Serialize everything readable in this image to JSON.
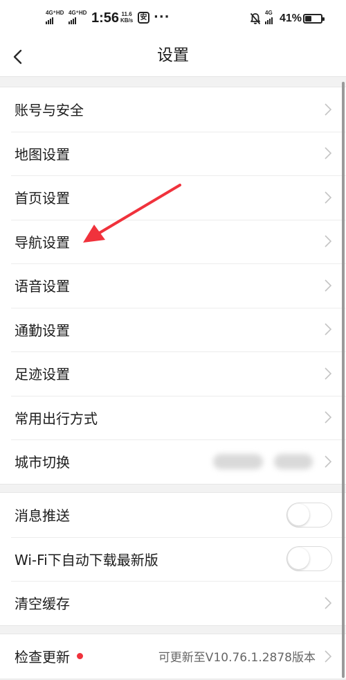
{
  "status_bar": {
    "net1": "4G⁺HD",
    "net2": "4G⁺HD",
    "time": "1:56",
    "speed_value": "11.6",
    "speed_unit": "KB/s",
    "app_icon_glyph": "安",
    "more": "···",
    "net3": "4G",
    "battery": "41%",
    "battery_level": 0.41
  },
  "header": {
    "title": "设置"
  },
  "group1": {
    "items": [
      {
        "label": "账号与安全"
      },
      {
        "label": "地图设置"
      },
      {
        "label": "首页设置"
      },
      {
        "label": "导航设置"
      },
      {
        "label": "语音设置"
      },
      {
        "label": "通勤设置"
      },
      {
        "label": "足迹设置"
      },
      {
        "label": "常用出行方式"
      },
      {
        "label": "城市切换"
      }
    ]
  },
  "group2": {
    "push_label": "消息推送",
    "push_enabled": false,
    "wifi_label": "Wi-Fi下自动下载最新版",
    "wifi_enabled": false,
    "cache_label": "清空缓存"
  },
  "group3": {
    "update_label": "检查更新",
    "update_value": "可更新至V10.76.1.2878版本"
  },
  "colors": {
    "background": "#f2f2f2",
    "card": "#ffffff",
    "accent_red": "#f0323c",
    "annotation_arrow": "#f0323c"
  },
  "icons": {
    "back": "chevron-left-icon",
    "row_arrow": "chevron-right-icon",
    "bell": "bell-off-icon"
  }
}
